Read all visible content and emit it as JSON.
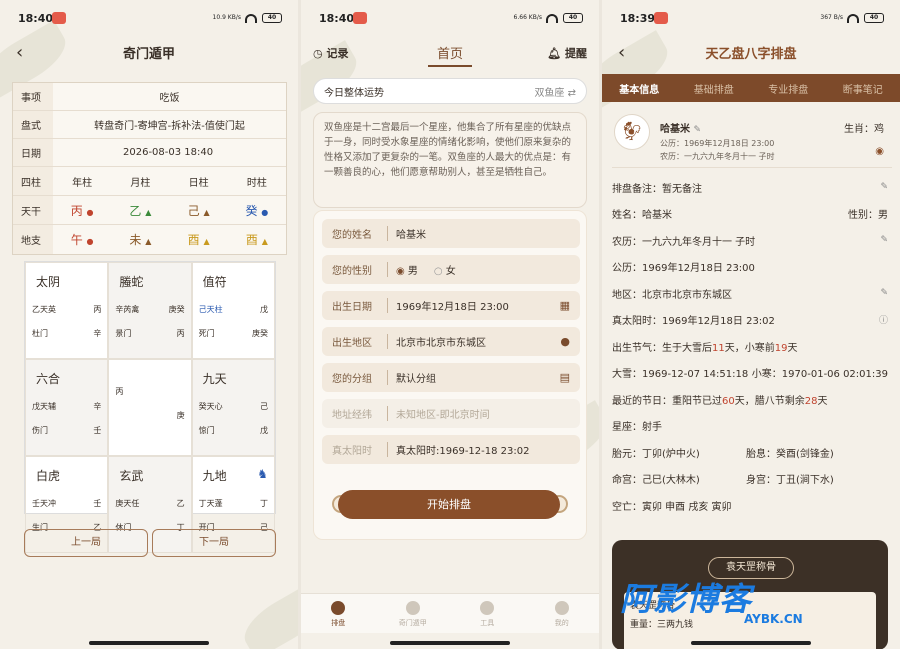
{
  "status": {
    "s1_time": "18:40",
    "s2_time": "18:40",
    "s3_time": "18:39",
    "s1_net": "10.9 KB/s",
    "s2_net": "6.66 KB/s",
    "s3_net": "367 B/s",
    "battery": "40"
  },
  "s1": {
    "title": "奇门遁甲",
    "rows": [
      {
        "k": "事项",
        "v": "吃饭"
      },
      {
        "k": "盘式",
        "v": "转盘奇门-寄坤宫-拆补法-值使门起"
      },
      {
        "k": "日期",
        "v": "2026-08-03 18:40"
      }
    ],
    "pillar_header": {
      "k": "四柱",
      "cols": [
        "年柱",
        "月柱",
        "日柱",
        "时柱"
      ]
    },
    "tiangan": {
      "k": "天干",
      "cols": [
        "丙",
        "乙",
        "己",
        "癸"
      ]
    },
    "dizhi": {
      "k": "地支",
      "cols": [
        "午",
        "未",
        "酉",
        "酉"
      ]
    },
    "palaces": [
      {
        "name": "太阴",
        "l1a": "乙天英",
        "l1b": "丙",
        "l2a": "杜门",
        "l2b": "辛"
      },
      {
        "name": "螣蛇",
        "l1a": "辛芮禽",
        "l1b": "庚癸",
        "l2a": "景门",
        "l2b": "丙"
      },
      {
        "name": "值符",
        "l1a": "己天柱",
        "l1b": "戊",
        "l2a": "死门",
        "l2b": "庚癸"
      },
      {
        "name": "六合",
        "l1a": "戊天辅",
        "l1b": "辛",
        "l2a": "伤门",
        "l2b": "壬"
      },
      {
        "name": "",
        "l1a": "丙",
        "l1b": "",
        "l2a": "",
        "l2b": "庚"
      },
      {
        "name": "九天",
        "l1a": "癸天心",
        "l1b": "己",
        "l2a": "惊门",
        "l2b": "戊"
      },
      {
        "name": "白虎",
        "l1a": "壬天冲",
        "l1b": "壬",
        "l2a": "生门",
        "l2b": "乙"
      },
      {
        "name": "玄武",
        "l1a": "庚天任",
        "l1b": "乙",
        "l2a": "休门",
        "l2b": "丁"
      },
      {
        "name": "九地",
        "l1a": "丁天蓬",
        "l1b": "丁",
        "l2a": "开门",
        "l2b": "己"
      }
    ],
    "prev": "上一局",
    "next": "下一局"
  },
  "s2": {
    "records": "记录",
    "home": "首页",
    "remind": "提醒",
    "fortune_title": "今日整体运势",
    "fortune_sign": "双鱼座 ⇄",
    "description": "双鱼座是十二宫最后一个星座，他集合了所有星座的优缺点于一身，同时受水象星座的情绪化影响，使他们原来复杂的性格又添加了更复杂的一笔。双鱼座的人最大的优点是：有一颗善良的心，他们愿意帮助别人，甚至是牺牲自己。",
    "name_label": "您的姓名",
    "name_value": "哈基米",
    "gender_label": "您的性别",
    "male": "男",
    "female": "女",
    "birth_label": "出生日期",
    "birth_value": "1969年12月18日 23:00",
    "place_label": "出生地区",
    "place_value": "北京市北京市东城区",
    "group_label": "您的分组",
    "group_value": "默认分组",
    "lnglat_label": "地址经纬",
    "lnglat_value": "未知地区-即北京时间",
    "solar_label": "真太阳时",
    "solar_value": "真太阳时:1969-12-18 23:02",
    "start": "开始排盘",
    "tabs": [
      "排盘",
      "奇门遁甲",
      "工具",
      "我的"
    ]
  },
  "s3": {
    "title": "天乙盘八字排盘",
    "tabs": [
      "基本信息",
      "基础排盘",
      "专业排盘",
      "断事笔记"
    ],
    "name": "哈基米",
    "gregorian_line": "公历：1969年12月18日 23:00",
    "lunar_line": "农历：一九六九年冬月十一  子时",
    "zodiac": "生肖：鸡",
    "note": "排盘备注：暂无备注",
    "name_row": "姓名：哈基米",
    "gender_row": "性别：男",
    "lunar_row": "农历：一九六九年冬月十一  子时",
    "gregorian_row": "公历：1969年12月18日 23:00",
    "area_row": "地区：北京市北京市东城区",
    "solar_row": "真太阳时：1969年12月18日 23:02",
    "term_pre": "出生节气：生于大雪后",
    "term_n1": "11",
    "term_mid": "天，小寒前",
    "term_n2": "19",
    "term_post": "天",
    "daxue": "大雪：1969-12-07 14:51:18",
    "xiaohan": "小寒：1970-01-06 02:01:39",
    "fest_pre": "最近的节日：重阳节已过",
    "fest_n1": "60",
    "fest_mid": "天，腊八节剩余",
    "fest_n2": "28",
    "fest_post": "天",
    "star": "星座：射手",
    "taiyuan": "胎元：丁卯(炉中火)",
    "taixi": "胎息：癸酉(剑锋金)",
    "minggong": "命宫：己巳(大林木)",
    "shengong": "身宫：丁丑(涧下水)",
    "kongwang": "空亡：寅卯 申酉 戌亥 寅卯",
    "card_pill": "袁天罡称骨",
    "card_text": "袁天罡称骨",
    "card_sub": "重量：三两九钱"
  },
  "watermark": {
    "main": "阿影博客",
    "sub": "AYBK.CN"
  },
  "colors": {
    "brown": "#7d4a2a",
    "accent_red": "#c0442e",
    "bg": "#f4f0e8"
  }
}
